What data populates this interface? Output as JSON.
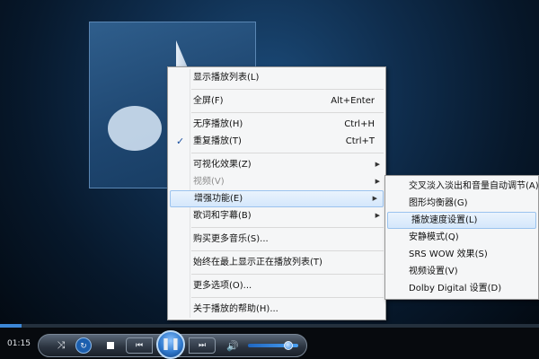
{
  "context_menu": {
    "items": [
      {
        "label": "显示播放列表(L)"
      },
      {
        "label": "全屏(F)",
        "shortcut": "Alt+Enter"
      },
      {
        "label": "无序播放(H)",
        "shortcut": "Ctrl+H"
      },
      {
        "label": "重复播放(T)",
        "shortcut": "Ctrl+T",
        "checked": true,
        "check_glyph": "✓"
      },
      {
        "label": "可视化效果(Z)",
        "submenu": true
      },
      {
        "label": "视频(V)",
        "submenu": true,
        "disabled": true
      },
      {
        "label": "增强功能(E)",
        "submenu": true,
        "highlighted": true
      },
      {
        "label": "歌词和字幕(B)",
        "submenu": true
      },
      {
        "label": "购买更多音乐(S)..."
      },
      {
        "label": "始终在最上显示正在播放列表(T)"
      },
      {
        "label": "更多选项(O)..."
      },
      {
        "label": "关于播放的帮助(H)..."
      }
    ],
    "arrow_glyph": "▶"
  },
  "enhancements_submenu": {
    "items": [
      {
        "label": "交叉淡入淡出和音量自动调节(A)"
      },
      {
        "label": "图形均衡器(G)"
      },
      {
        "label": "播放速度设置(L)",
        "highlighted": true
      },
      {
        "label": "安静模式(Q)"
      },
      {
        "label": "SRS WOW 效果(S)"
      },
      {
        "label": "视频设置(V)"
      },
      {
        "label": "Dolby Digital 设置(D)"
      }
    ]
  },
  "player": {
    "elapsed_time": "01:15",
    "seek_progress": 0.04,
    "volume_level": 0.8,
    "controls": {
      "shuffle_glyph": "⤨",
      "repeat_glyph": "↻",
      "prev_glyph": "⏮",
      "play_pause_glyph": "❚❚",
      "next_glyph": "⏭",
      "volume_glyph": "🔊"
    }
  },
  "colors": {
    "accent": "#3c87d6",
    "menu_highlight": "#d4e7fb"
  }
}
